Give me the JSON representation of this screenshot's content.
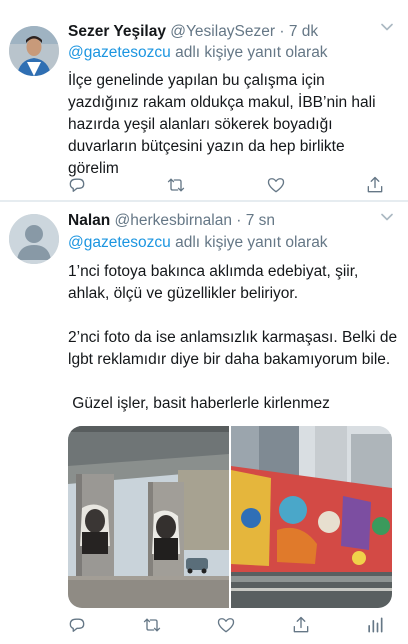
{
  "tweets": [
    {
      "name": "Sezer Yeşilay",
      "handle": "@YesilaySezer",
      "separator": "·",
      "time": "7 dk",
      "reply_mention": "@gazetesozcu",
      "reply_suffix": " adlı kişiye yanıt olarak",
      "text": "İlçe genelinde yapılan bu çalışma için yazdığınız rakam oldukça makul, İBB’nin hali hazırda yeşil alanları sökerek boyadığı duvarların bütçesini yazın da hep birlikte görelim"
    },
    {
      "name": "Nalan",
      "handle": "@herkesbirnalan",
      "separator": "·",
      "time": "7 sn",
      "reply_mention": "@gazetesozcu",
      "reply_suffix": " adlı kişiye yanıt olarak",
      "paragraphs": [
        "1’nci fotoya bakınca aklımda edebiyat, şiir, ahlak, ölçü ve  güzellikler beliriyor.",
        "2’nci foto da ise anlamsızlık karmaşası. Belki de lgbt reklamıdır diye bir daha bakamıyorum bile.",
        " Güzel işler, basit haberlerle kirlenmez"
      ]
    }
  ],
  "icons": {
    "reply": "reply-icon",
    "retweet": "retweet-icon",
    "like": "heart-icon",
    "share": "share-icon",
    "analytics": "analytics-icon",
    "menu": "chevron-down-icon"
  },
  "colors": {
    "link": "#1b95e0",
    "secondary": "#657786",
    "divider": "#e6ecf0"
  }
}
